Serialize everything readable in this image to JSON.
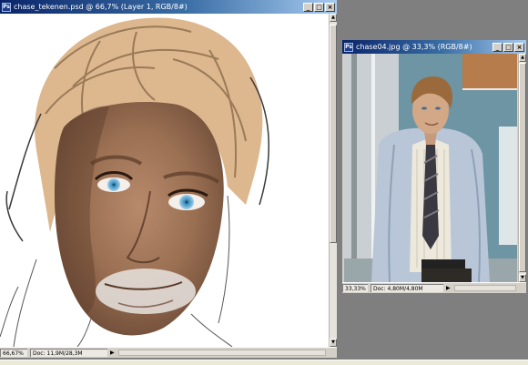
{
  "windows": {
    "drawing": {
      "title": "chase_tekenen.psd @ 66,7% (Layer 1, RGB/8#)",
      "zoom": "66,67%",
      "doc_size": "Doc: 11,9M/28,3M",
      "controls": {
        "minimize": "_",
        "maximize": "□",
        "close": "×"
      }
    },
    "reference": {
      "title": "chase04.jpg @ 33,3% (RGB/8#)",
      "zoom": "33,33%",
      "doc_size": "Doc: 4,80M/4,80M",
      "controls": {
        "minimize": "_",
        "maximize": "□",
        "close": "×"
      }
    }
  },
  "colors": {
    "title_active": "#0a246a",
    "title_gradient_end": "#a6caf0",
    "chrome": "#d4d0c8",
    "workspace": "#7f7f7f"
  },
  "icons": {
    "app": "photoshop-document-icon",
    "status_arrow": "play-triangle-icon"
  }
}
